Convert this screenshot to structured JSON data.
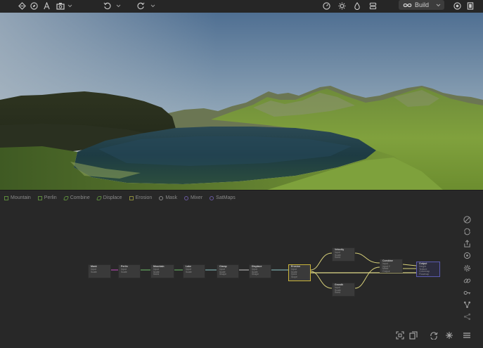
{
  "toolbar": {
    "build_label": "Build",
    "left_icons": [
      "layers-icon",
      "compass-icon",
      "pen-icon",
      "camera-icon",
      "chevron-down-icon"
    ],
    "history_icons": [
      "undo-icon",
      "chevron-down-icon",
      "redo-icon",
      "chevron-down-icon"
    ],
    "right_icons": [
      "gauge-icon",
      "sun-icon",
      "droplet-icon",
      "stack-icon",
      "infinity-icon",
      "chevron-down-icon",
      "record-icon",
      "window-icon"
    ]
  },
  "legend": [
    {
      "label": "Mountain",
      "color": "#5c8a3c",
      "shape": "square"
    },
    {
      "label": "Perlin",
      "color": "#5c8a3c",
      "shape": "square"
    },
    {
      "label": "Combine",
      "color": "#5c8a3c",
      "shape": "slant"
    },
    {
      "label": "Displace",
      "color": "#5c8a3c",
      "shape": "slant"
    },
    {
      "label": "Erosion",
      "color": "#8a8a3c",
      "shape": "square"
    },
    {
      "label": "Mask",
      "color": "#8a8a8a",
      "shape": "circle"
    },
    {
      "label": "Mixer",
      "color": "#6a5aa0",
      "shape": "circle"
    },
    {
      "label": "SatMaps",
      "color": "#6a5aa0",
      "shape": "circle"
    }
  ],
  "nodes": [
    {
      "title": "Mask",
      "ports": [
        "Input",
        "Scale"
      ]
    },
    {
      "title": "Perlin",
      "ports": [
        "Input",
        "Scale"
      ]
    },
    {
      "title": "Mountain",
      "ports": [
        "Input",
        "Scale",
        "Seed"
      ]
    },
    {
      "title": "Lake",
      "ports": [
        "Input",
        "Scale"
      ]
    },
    {
      "title": "Clamp",
      "ports": [
        "Input",
        "Scale",
        "Shape"
      ]
    },
    {
      "title": "Displace",
      "ports": [
        "Input",
        "Scale",
        "Shape"
      ]
    },
    {
      "title": "Erosion",
      "ports": [
        "Input",
        "Scale",
        "Seed",
        "Slope"
      ]
    },
    {
      "title": "Velocity",
      "ports": [
        "Input",
        "Scale",
        "Seed"
      ]
    },
    {
      "title": "Growth",
      "ports": [
        "Input",
        "Scale",
        "Seed"
      ]
    },
    {
      "title": "Combine",
      "ports": [
        "Input",
        "Input 2",
        "Mask",
        "Output"
      ]
    },
    {
      "title": "Output",
      "ports": [
        "Height",
        "Texture",
        "Colormap",
        "Flowmap"
      ]
    }
  ],
  "right_tools": [
    "slash-circle-icon",
    "refresh-icon",
    "export-icon",
    "target-icon",
    "gear-icon",
    "link-icon",
    "key-icon",
    "nodes-icon",
    "share-icon"
  ],
  "bottom_tools": [
    "fit-icon",
    "copy-icon",
    "loop-icon",
    "sparkle-icon",
    "menu-icon"
  ]
}
